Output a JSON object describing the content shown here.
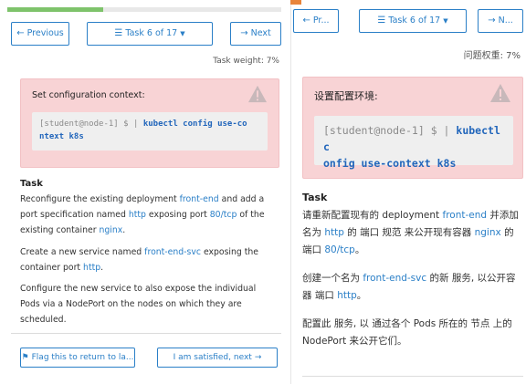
{
  "left": {
    "progress_percent": 35,
    "nav": {
      "prev_label": "Previous",
      "task_label": "Task 6 of 17",
      "next_label": "Next"
    },
    "weight": "Task weight: 7%",
    "context": {
      "title": "Set configuration context:",
      "prompt": "[student@node-1] $",
      "cmd_line1": "kubectl config use-co",
      "cmd_line2": "ntext k8s"
    },
    "task": {
      "heading": "Task",
      "p1_a": "Reconfigure the existing deployment",
      "p1_code1": "front-end",
      "p1_b": "and add a port specification named",
      "p1_code2": "http",
      "p1_c": "exposing port",
      "p1_code3": "80/tcp",
      "p1_d": "of the existing container",
      "p1_code4": "nginx",
      "p1_e": ".",
      "p2_a": "Create a new service named",
      "p2_code1": "front-end-svc",
      "p2_b": "exposing the container port",
      "p2_code2": "http",
      "p2_c": ".",
      "p3": "Configure the new service to also expose the individual Pods via a NodePort on the nodes on which they are scheduled."
    },
    "footer": {
      "flag_label": "Flag this to return to la...",
      "next_label": "I am satisfied, next"
    }
  },
  "right": {
    "nav": {
      "prev_label": "Pr...",
      "task_label": "Task 6 of 17",
      "next_label": "N..."
    },
    "weight": "问题权重: 7%",
    "context": {
      "title": "设置配置环境:",
      "prompt": "[student@node-1] $",
      "cmd_line1": "kubectl c",
      "cmd_line2": "onfig use-context k8s"
    },
    "task": {
      "heading": "Task",
      "p1_a": "请重新配置现有的 deployment",
      "p1_code1": "front-end",
      "p1_b": "并添加名为",
      "p1_code2": "http",
      "p1_c": "的 端口 规范 来公开现有容器",
      "p1_code3": "nginx",
      "p1_d": "的 端口",
      "p1_code4": "80/tcp",
      "p1_e": "。",
      "p2_a": "创建一个名为",
      "p2_code1": "front-end-svc",
      "p2_b": "的新 服务, 以公开容器 端口",
      "p2_code2": "http",
      "p2_c": "。",
      "p3": "配置此 服务, 以 通过各个 Pods 所在的 节点 上的 NodePort 来公开它们。"
    }
  },
  "colors": {
    "accent": "#2a7fc7",
    "alert_bg": "#f8d3d5",
    "progress": "#7ec36b",
    "top_badge": "#e8843a"
  }
}
